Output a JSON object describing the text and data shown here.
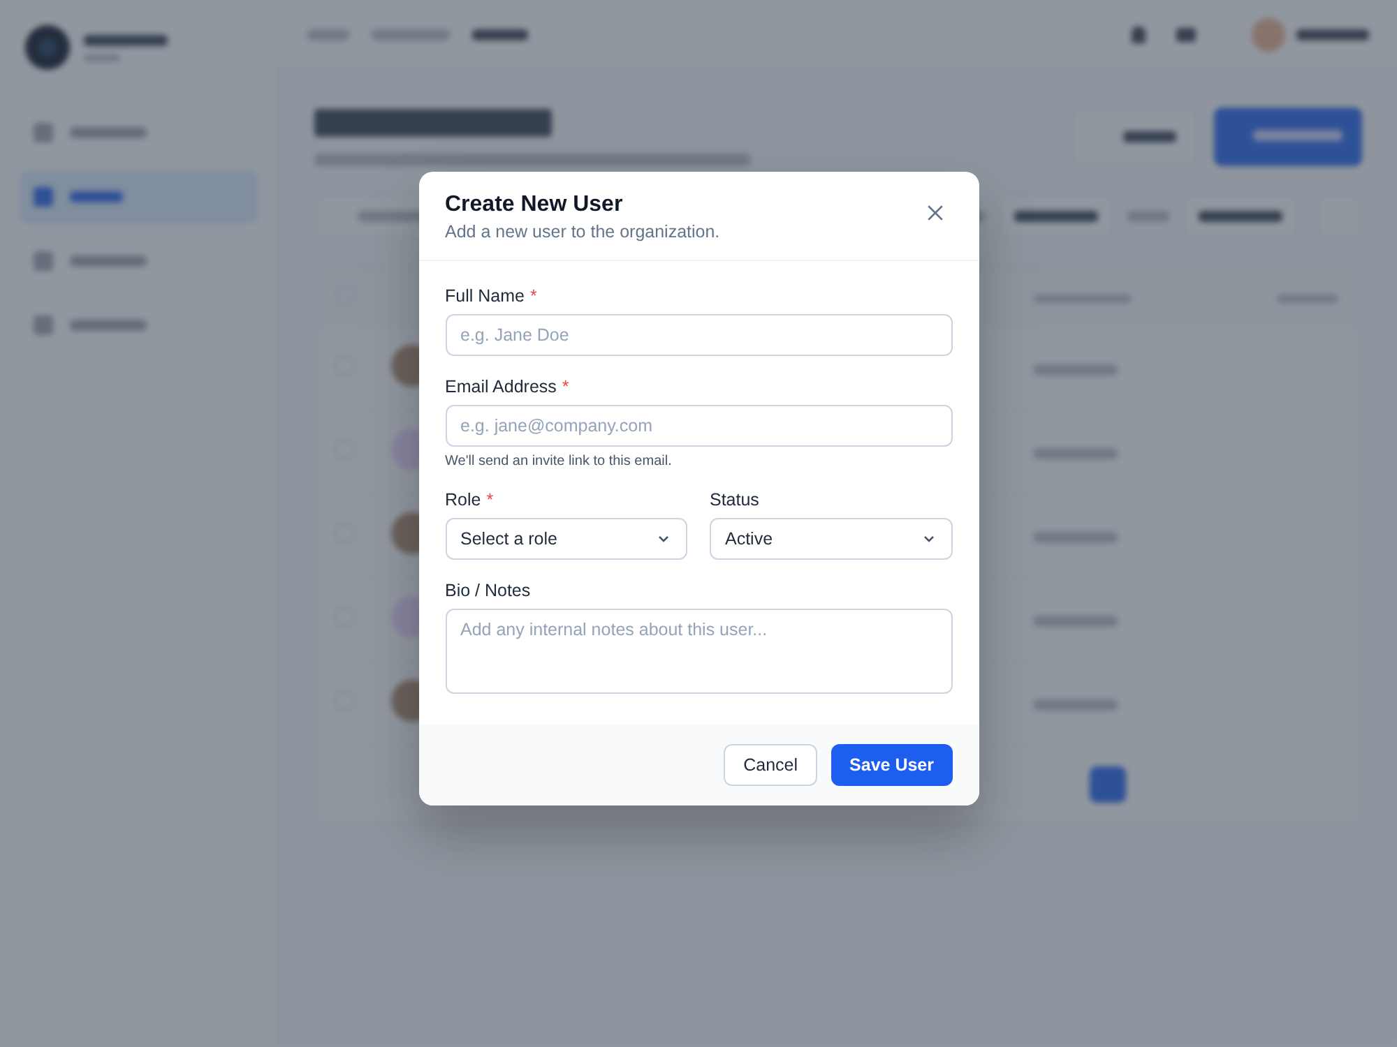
{
  "modal": {
    "title": "Create New User",
    "subtitle": "Add a new user to the organization.",
    "fields": [
      {
        "kind": "text",
        "label": "Full Name",
        "required_mark": "*",
        "placeholder": "e.g. Jane Doe"
      },
      {
        "kind": "text",
        "label": "Email Address",
        "required_mark": "*",
        "placeholder": "e.g. jane@company.com",
        "help": "We'll send an invite link to this email."
      },
      {
        "kind": "select",
        "label": "Role",
        "required_mark": "*",
        "value": "Select a role"
      },
      {
        "kind": "select",
        "label": "Status",
        "value": "Active"
      },
      {
        "kind": "textarea",
        "label": "Bio / Notes",
        "placeholder": "Add any internal notes about this user..."
      }
    ],
    "cancel_button": "Cancel",
    "save_button": "Save User"
  }
}
